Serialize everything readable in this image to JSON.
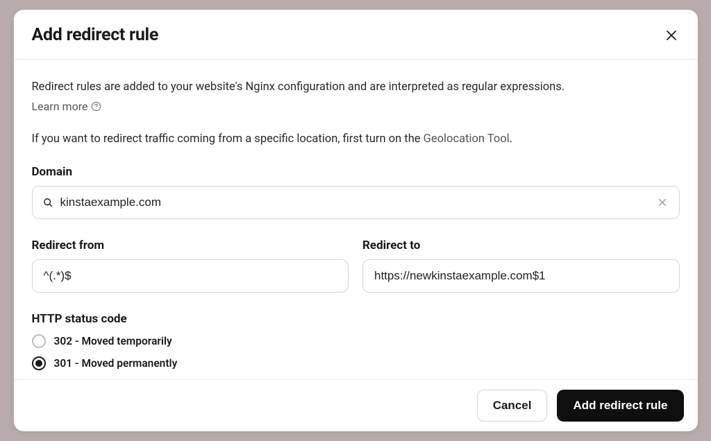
{
  "modal": {
    "title": "Add redirect rule",
    "close_aria": "Close"
  },
  "intro": {
    "text": "Redirect rules are added to your website's Nginx configuration and are interpreted as regular expressions.",
    "learn_more": "Learn more",
    "geo_prefix": "If you want to redirect traffic coming from a specific location, first turn on the ",
    "geo_link": "Geolocation Tool",
    "geo_suffix": "."
  },
  "fields": {
    "domain": {
      "label": "Domain",
      "value": "kinstaexample.com",
      "clear_aria": "Clear"
    },
    "redirect_from": {
      "label": "Redirect from",
      "value": "^(.*)$"
    },
    "redirect_to": {
      "label": "Redirect to",
      "value": "https://newkinstaexample.com$1"
    },
    "status": {
      "label": "HTTP status code",
      "options": [
        {
          "label": "302 - Moved temporarily",
          "selected": false
        },
        {
          "label": "301 - Moved permanently",
          "selected": true
        }
      ]
    }
  },
  "footer": {
    "cancel": "Cancel",
    "submit": "Add redirect rule"
  }
}
